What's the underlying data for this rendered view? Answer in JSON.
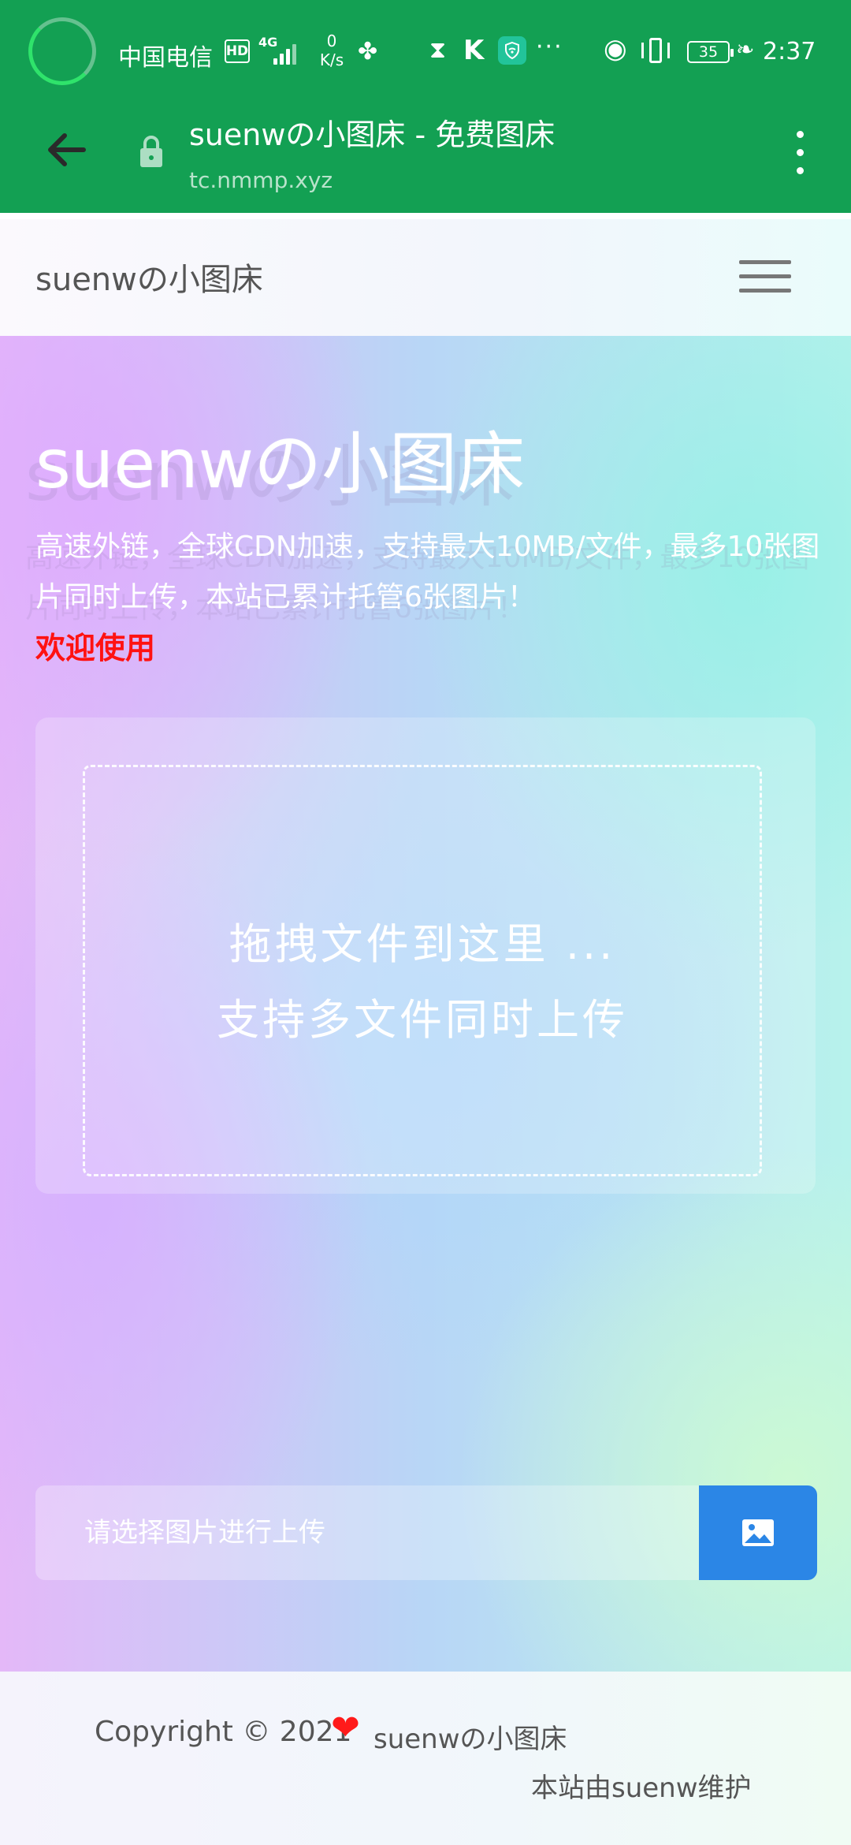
{
  "status_bar": {
    "carrier": "中国电信",
    "hd": "HD",
    "network": "4G",
    "speed_value": "0",
    "speed_unit": "K/s",
    "battery": "35",
    "time": "2:37"
  },
  "browser": {
    "title": "suenwの小图床 - 免费图床",
    "url": "tc.nmmp.xyz"
  },
  "nav": {
    "brand": "suenwの小图床"
  },
  "hero": {
    "title": "suenwの小图床",
    "description": "高速外链，全球CDN加速，支持最大10MB/文件，最多10张图片同时上传，本站已累计托管6张图片！",
    "welcome": "欢迎使用"
  },
  "upload": {
    "drop_line1": "拖拽文件到这里 ...",
    "drop_line2": "支持多文件同时上传",
    "input_placeholder": "请选择图片进行上传"
  },
  "footer": {
    "copyright": "Copyright © 2021",
    "brand": "suenwの小图床",
    "maintainer": "本站由suenw维护"
  },
  "colors": {
    "browser_bar": "#13a053",
    "upload_button": "#2b86e6",
    "welcome_text": "#ff1212",
    "heart": "#ff1a1a"
  },
  "icons": [
    "loading-ring-icon",
    "back-arrow-icon",
    "lock-icon",
    "more-vert-icon",
    "hamburger-menu-icon",
    "image-icon",
    "heart-icon"
  ]
}
